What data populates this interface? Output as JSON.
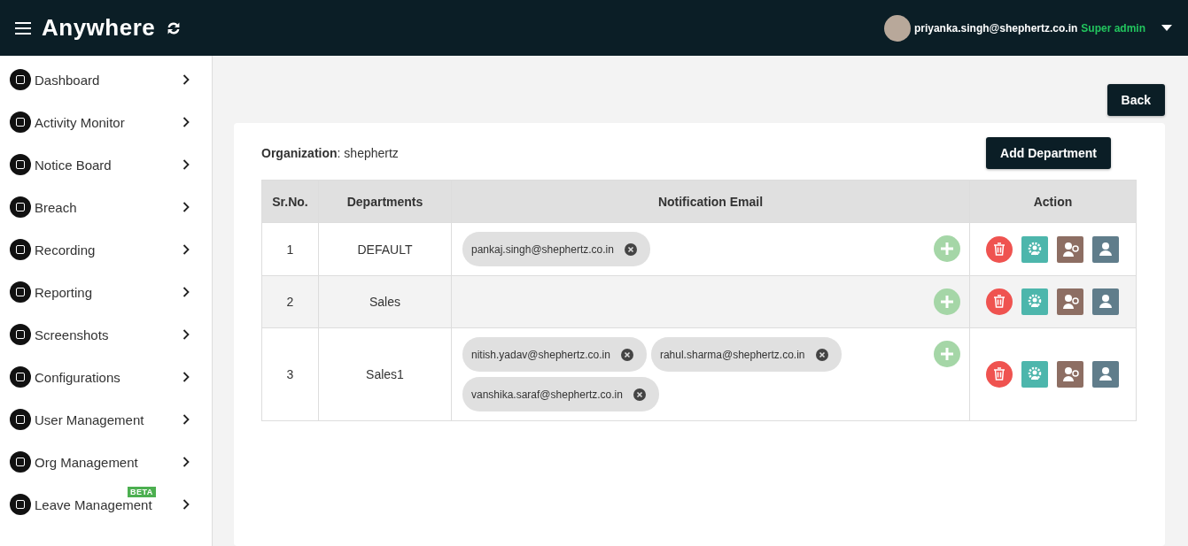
{
  "header": {
    "brand": "Anywhere",
    "user_email": "priyanka.singh@shephertz.co.in",
    "user_role": "Super admin"
  },
  "sidebar": {
    "items": [
      {
        "label": "Dashboard"
      },
      {
        "label": "Activity Monitor"
      },
      {
        "label": "Notice Board"
      },
      {
        "label": "Breach"
      },
      {
        "label": "Recording"
      },
      {
        "label": "Reporting"
      },
      {
        "label": "Screenshots"
      },
      {
        "label": "Configurations"
      },
      {
        "label": "User Management"
      },
      {
        "label": "Org Management"
      },
      {
        "label": "Leave Management",
        "badge": "BETA"
      }
    ]
  },
  "back_button": "Back",
  "organization": "**Organization**: shephertz",
  "add_department_button": "Add Department",
  "table": {
    "columns": [
      "Sr.No.",
      "Departments",
      "Notification Email",
      "Action"
    ],
    "rows": [
      {
        "sr_no": "1",
        "department": "DEFAULT",
        "emails": [
          "pankaj.singh@shephertz.co.in"
        ]
      },
      {
        "sr_no": "2",
        "department": "Sales",
        "emails": []
      },
      {
        "sr_no": "3",
        "department": "Sales1",
        "emails": [
          "nitish.yadav@shephertz.co.in",
          "rahul.sharma@shephertz.co.in",
          "vanshika.saraf@shephertz.co.in"
        ]
      }
    ]
  }
}
